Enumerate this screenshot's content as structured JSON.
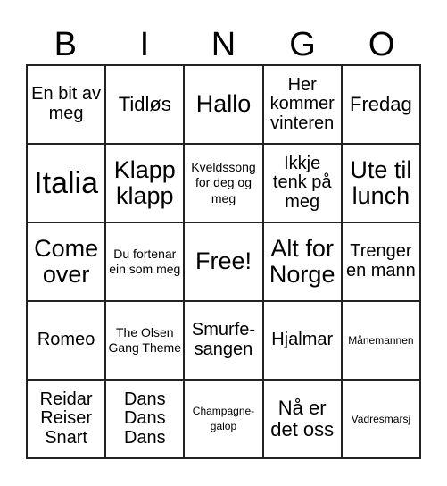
{
  "header": [
    "B",
    "I",
    "N",
    "G",
    "O"
  ],
  "cells": [
    [
      "En bit av meg",
      "Tidløs",
      "Hallo",
      "Her kommer vinteren",
      "Fredag"
    ],
    [
      "Italia",
      "Klapp klapp",
      "Kveldssong for deg og meg",
      "Ikkje tenk på meg",
      "Ute til lunch"
    ],
    [
      "Come over",
      "Du fortenar ein som meg",
      "Free!",
      "Alt for Norge",
      "Trenger en mann"
    ],
    [
      "Romeo",
      "The Olsen Gang Theme",
      "Smurfe-sangen",
      "Hjalmar",
      "Månemannen"
    ],
    [
      "Reidar Reiser Snart",
      "Dans Dans Dans",
      "Champagne-galop",
      "Nå er det oss",
      "Vadresmarsj"
    ]
  ]
}
